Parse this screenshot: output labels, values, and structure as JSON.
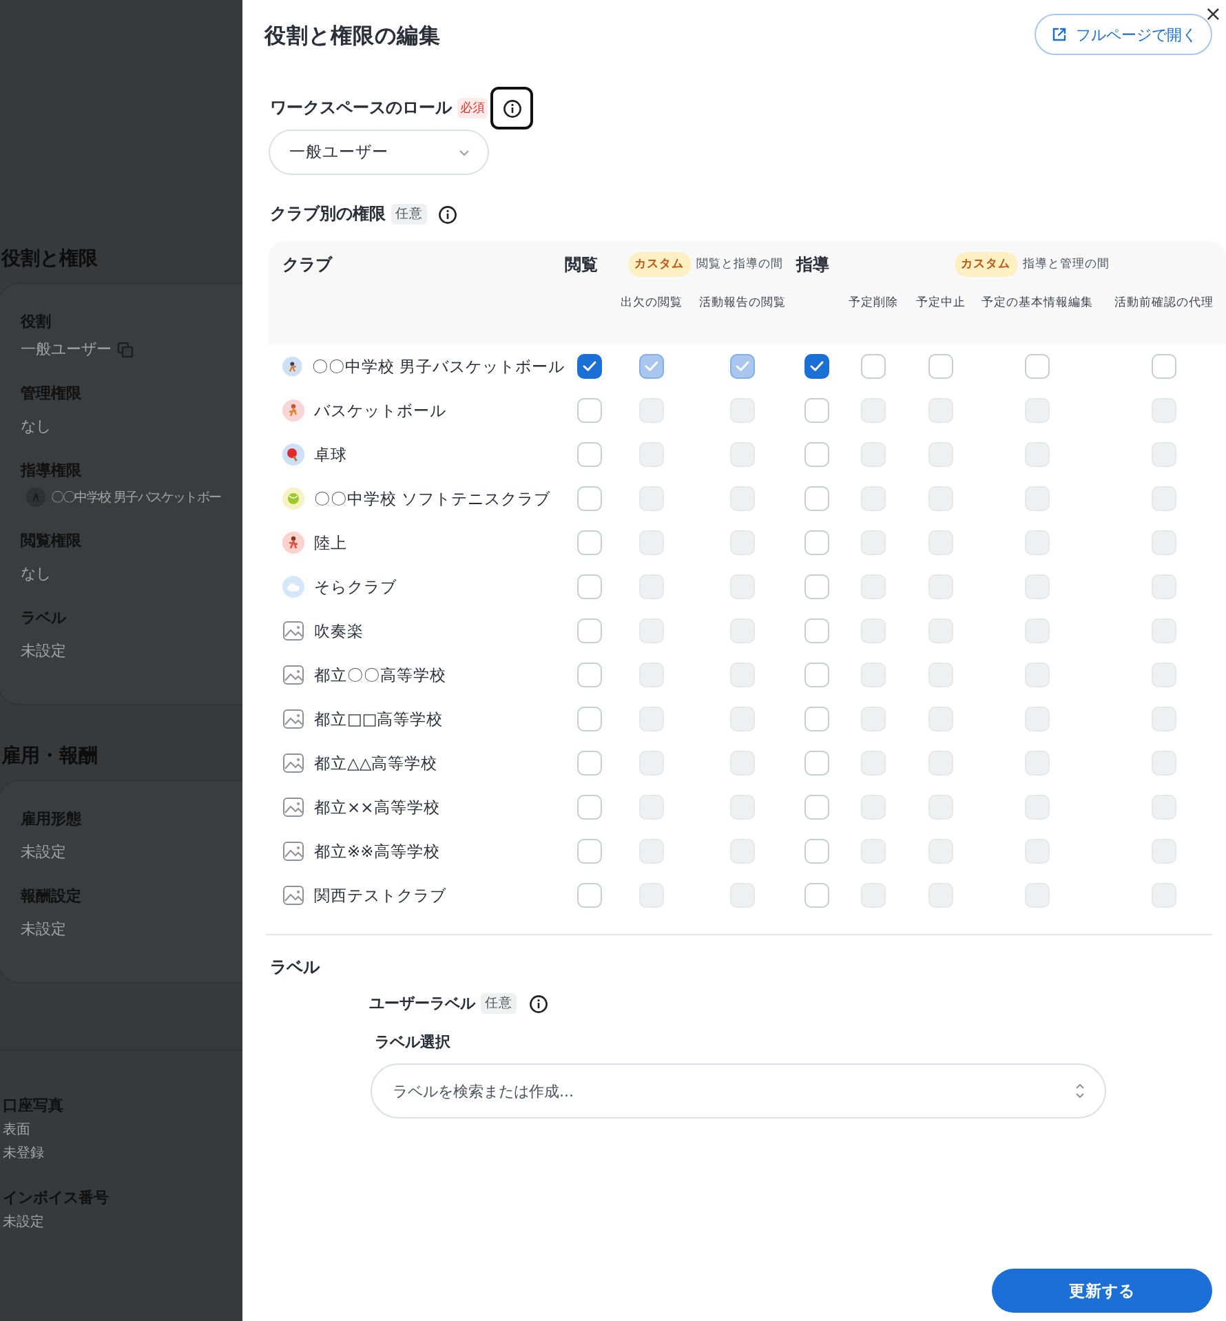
{
  "background_page": {
    "sections": [
      {
        "title": "役割と権限",
        "fields": [
          {
            "kind": "copyable",
            "label": "役割",
            "value": "一般ユーザー"
          },
          {
            "kind": "text",
            "label": "管理権限",
            "value": "なし"
          },
          {
            "kind": "chip",
            "label": "指導権限",
            "value": "〇〇中学校 男子バスケットボー"
          },
          {
            "kind": "text",
            "label": "閲覧権限",
            "value": "なし"
          },
          {
            "kind": "text",
            "label": "ラベル",
            "value": "未設定"
          }
        ]
      },
      {
        "title": "雇用・報酬",
        "fields": [
          {
            "kind": "text",
            "label": "雇用形態",
            "value": "未設定"
          },
          {
            "kind": "text",
            "label": "報酬設定",
            "value": "未設定"
          }
        ]
      }
    ],
    "extra_fields": [
      {
        "label": "口座写真",
        "lines": [
          "表面",
          "未登録"
        ]
      },
      {
        "label": "インボイス番号",
        "lines": [
          "未設定"
        ]
      }
    ]
  },
  "drawer": {
    "title": "役割と権限の編集",
    "open_full_page": "フルページで開く",
    "close": "×",
    "workspace_role": {
      "label": "ワークスペースのロール",
      "required": "必須",
      "value": "一般ユーザー"
    },
    "club_permissions": {
      "label": "クラブ別の権限",
      "optional": "任意",
      "table": {
        "club_column": "クラブ",
        "columns": [
          {
            "kind": "level",
            "label": "閲覧"
          },
          {
            "kind": "custom",
            "label": "出欠の閲覧"
          },
          {
            "kind": "custom",
            "label": "活動報告の閲覧"
          },
          {
            "kind": "level",
            "label": "指導"
          },
          {
            "kind": "custom",
            "label": "予定削除"
          },
          {
            "kind": "custom",
            "label": "予定中止"
          },
          {
            "kind": "custom",
            "label": "予定の基本情報編集"
          },
          {
            "kind": "custom",
            "label": "活動前確認の代理"
          }
        ],
        "custom_groups": [
          {
            "badge": "カスタム",
            "label": "閲覧と指導の間"
          },
          {
            "badge": "カスタム",
            "label": "指導と管理の間"
          }
        ],
        "rows": [
          {
            "name": "〇〇中学校 男子バスケットボール",
            "kind": "avatar",
            "color": "#cfe0f5",
            "cells": [
              {
                "checked": true,
                "disabled": false
              },
              {
                "checked": true,
                "disabled": true
              },
              {
                "checked": true,
                "disabled": true
              },
              {
                "checked": true,
                "disabled": false
              },
              {
                "checked": false,
                "disabled": false
              },
              {
                "checked": false,
                "disabled": false
              },
              {
                "checked": false,
                "disabled": false
              },
              {
                "checked": false,
                "disabled": false
              }
            ]
          },
          {
            "name": "バスケットボール",
            "kind": "avatar",
            "color": "#f8d6d6",
            "cells": [
              {
                "checked": false,
                "disabled": false
              },
              {
                "checked": false,
                "disabled": true
              },
              {
                "checked": false,
                "disabled": true
              },
              {
                "checked": false,
                "disabled": false
              },
              {
                "checked": false,
                "disabled": true
              },
              {
                "checked": false,
                "disabled": true
              },
              {
                "checked": false,
                "disabled": true
              },
              {
                "checked": false,
                "disabled": true
              }
            ]
          },
          {
            "name": "卓球",
            "kind": "avatar",
            "color": "#cde0f7",
            "cells": [
              {
                "checked": false,
                "disabled": false
              },
              {
                "checked": false,
                "disabled": true
              },
              {
                "checked": false,
                "disabled": true
              },
              {
                "checked": false,
                "disabled": false
              },
              {
                "checked": false,
                "disabled": true
              },
              {
                "checked": false,
                "disabled": true
              },
              {
                "checked": false,
                "disabled": true
              },
              {
                "checked": false,
                "disabled": true
              }
            ]
          },
          {
            "name": "〇〇中学校 ソフトテニスクラブ",
            "kind": "avatar",
            "color": "#f7f2c4",
            "cells": [
              {
                "checked": false,
                "disabled": false
              },
              {
                "checked": false,
                "disabled": true
              },
              {
                "checked": false,
                "disabled": true
              },
              {
                "checked": false,
                "disabled": false
              },
              {
                "checked": false,
                "disabled": true
              },
              {
                "checked": false,
                "disabled": true
              },
              {
                "checked": false,
                "disabled": true
              },
              {
                "checked": false,
                "disabled": true
              }
            ]
          },
          {
            "name": "陸上",
            "kind": "avatar",
            "color": "#fbd2cd",
            "cells": [
              {
                "checked": false,
                "disabled": false
              },
              {
                "checked": false,
                "disabled": true
              },
              {
                "checked": false,
                "disabled": true
              },
              {
                "checked": false,
                "disabled": false
              },
              {
                "checked": false,
                "disabled": true
              },
              {
                "checked": false,
                "disabled": true
              },
              {
                "checked": false,
                "disabled": true
              },
              {
                "checked": false,
                "disabled": true
              }
            ]
          },
          {
            "name": "そらクラブ",
            "kind": "avatar",
            "color": "#d6e7f9",
            "cells": [
              {
                "checked": false,
                "disabled": false
              },
              {
                "checked": false,
                "disabled": true
              },
              {
                "checked": false,
                "disabled": true
              },
              {
                "checked": false,
                "disabled": false
              },
              {
                "checked": false,
                "disabled": true
              },
              {
                "checked": false,
                "disabled": true
              },
              {
                "checked": false,
                "disabled": true
              },
              {
                "checked": false,
                "disabled": true
              }
            ]
          },
          {
            "name": "吹奏楽",
            "kind": "image",
            "cells": [
              {
                "checked": false,
                "disabled": false
              },
              {
                "checked": false,
                "disabled": true
              },
              {
                "checked": false,
                "disabled": true
              },
              {
                "checked": false,
                "disabled": false
              },
              {
                "checked": false,
                "disabled": true
              },
              {
                "checked": false,
                "disabled": true
              },
              {
                "checked": false,
                "disabled": true
              },
              {
                "checked": false,
                "disabled": true
              }
            ]
          },
          {
            "name": "都立〇〇高等学校",
            "kind": "image",
            "cells": [
              {
                "checked": false,
                "disabled": false
              },
              {
                "checked": false,
                "disabled": true
              },
              {
                "checked": false,
                "disabled": true
              },
              {
                "checked": false,
                "disabled": false
              },
              {
                "checked": false,
                "disabled": true
              },
              {
                "checked": false,
                "disabled": true
              },
              {
                "checked": false,
                "disabled": true
              },
              {
                "checked": false,
                "disabled": true
              }
            ]
          },
          {
            "name": "都立□□高等学校",
            "kind": "image",
            "cells": [
              {
                "checked": false,
                "disabled": false
              },
              {
                "checked": false,
                "disabled": true
              },
              {
                "checked": false,
                "disabled": true
              },
              {
                "checked": false,
                "disabled": false
              },
              {
                "checked": false,
                "disabled": true
              },
              {
                "checked": false,
                "disabled": true
              },
              {
                "checked": false,
                "disabled": true
              },
              {
                "checked": false,
                "disabled": true
              }
            ]
          },
          {
            "name": "都立△△高等学校",
            "kind": "image",
            "cells": [
              {
                "checked": false,
                "disabled": false
              },
              {
                "checked": false,
                "disabled": true
              },
              {
                "checked": false,
                "disabled": true
              },
              {
                "checked": false,
                "disabled": false
              },
              {
                "checked": false,
                "disabled": true
              },
              {
                "checked": false,
                "disabled": true
              },
              {
                "checked": false,
                "disabled": true
              },
              {
                "checked": false,
                "disabled": true
              }
            ]
          },
          {
            "name": "都立××高等学校",
            "kind": "image",
            "cells": [
              {
                "checked": false,
                "disabled": false
              },
              {
                "checked": false,
                "disabled": true
              },
              {
                "checked": false,
                "disabled": true
              },
              {
                "checked": false,
                "disabled": false
              },
              {
                "checked": false,
                "disabled": true
              },
              {
                "checked": false,
                "disabled": true
              },
              {
                "checked": false,
                "disabled": true
              },
              {
                "checked": false,
                "disabled": true
              }
            ]
          },
          {
            "name": "都立※※高等学校",
            "kind": "image",
            "cells": [
              {
                "checked": false,
                "disabled": false
              },
              {
                "checked": false,
                "disabled": true
              },
              {
                "checked": false,
                "disabled": true
              },
              {
                "checked": false,
                "disabled": false
              },
              {
                "checked": false,
                "disabled": true
              },
              {
                "checked": false,
                "disabled": true
              },
              {
                "checked": false,
                "disabled": true
              },
              {
                "checked": false,
                "disabled": true
              }
            ]
          },
          {
            "name": "関西テストクラブ",
            "kind": "image",
            "cells": [
              {
                "checked": false,
                "disabled": false
              },
              {
                "checked": false,
                "disabled": true
              },
              {
                "checked": false,
                "disabled": true
              },
              {
                "checked": false,
                "disabled": false
              },
              {
                "checked": false,
                "disabled": true
              },
              {
                "checked": false,
                "disabled": true
              },
              {
                "checked": false,
                "disabled": true
              },
              {
                "checked": false,
                "disabled": true
              }
            ]
          }
        ]
      }
    },
    "label_section": {
      "title": "ラベル",
      "user_label": "ユーザーラベル",
      "optional": "任意",
      "select_label": "ラベル選択",
      "placeholder": "ラベルを検索または作成..."
    },
    "submit": "更新する"
  }
}
